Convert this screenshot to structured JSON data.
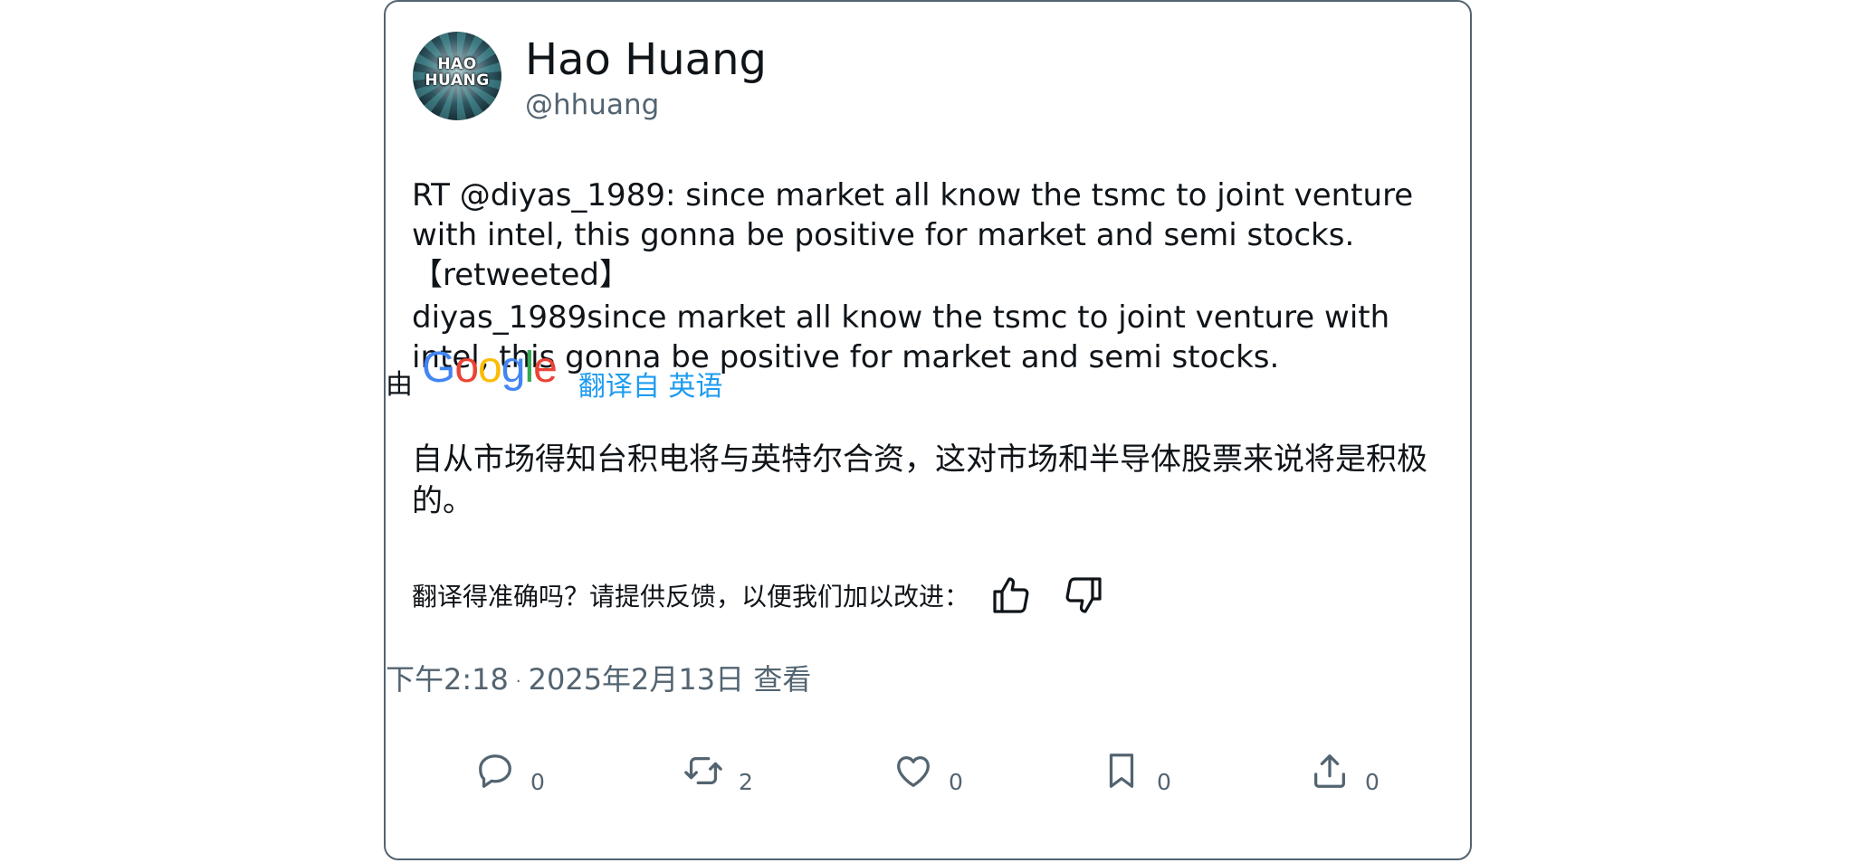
{
  "author": {
    "avatar_text_line1": "HAO",
    "avatar_text_line2": "HUANG",
    "display_name": "Hao Huang",
    "handle": "@hhuang"
  },
  "tweet": {
    "line1": "RT @diyas_1989: since market all know the tsmc to joint venture with intel, this gonna be positive for market and semi stocks. 【retweeted】",
    "line2": "diyas_1989since market all know the tsmc to joint venture with intel, this gonna be positive for market and semi stocks."
  },
  "translation": {
    "by_label": "由",
    "google_letters": [
      "G",
      "o",
      "o",
      "g",
      "l",
      "e"
    ],
    "translate_link": "翻译自 英语",
    "translated_text": "自从市场得知台积电将与英特尔合资，这对市场和半导体股票来说将是积极的。",
    "feedback_label": "翻译得准确吗？请提供反馈，以便我们加以改进："
  },
  "timestamp": {
    "time": "下午2:18",
    "separator": "·",
    "date": "2025年2月13日",
    "views_label": "查看"
  },
  "actions": {
    "reply_count": "0",
    "retweet_count": "2",
    "like_count": "0",
    "bookmark_count": "0",
    "share_count": "0"
  },
  "colors": {
    "link_blue": "#1d9bf0",
    "secondary_text": "#536471",
    "primary_text": "#0f1419"
  },
  "icons": [
    "reply-icon",
    "retweet-icon",
    "like-icon",
    "bookmark-icon",
    "share-icon",
    "thumbs-up-icon",
    "thumbs-down-icon"
  ]
}
